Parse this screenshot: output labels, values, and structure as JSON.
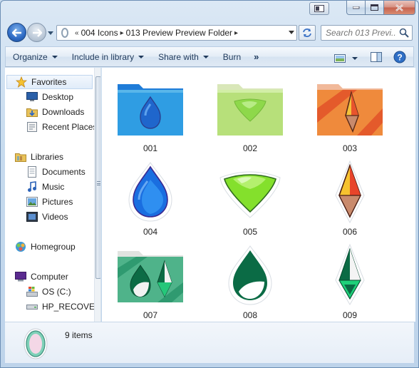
{
  "window": {
    "caption_buttons": [
      "minimize",
      "maximize",
      "close"
    ]
  },
  "nav": {
    "breadcrumbs": [
      "004 Icons",
      "013 Preview Preview Folder"
    ],
    "search_placeholder": "Search 013 Previ..."
  },
  "toolbar": {
    "organize": "Organize",
    "include": "Include in library",
    "share": "Share with",
    "burn": "Burn",
    "more": "»"
  },
  "sidebar": {
    "favorites": {
      "label": "Favorites",
      "items": [
        "Desktop",
        "Downloads",
        "Recent Places"
      ]
    },
    "libraries": {
      "label": "Libraries",
      "items": [
        "Documents",
        "Music",
        "Pictures",
        "Videos"
      ]
    },
    "homegroup": "Homegroup",
    "computer": {
      "label": "Computer",
      "items": [
        "OS (C:)",
        "HP_RECOVERY"
      ]
    }
  },
  "files": [
    {
      "name": "001",
      "icon": "blue-folder-drop-icon"
    },
    {
      "name": "002",
      "icon": "green-folder-gem-icon"
    },
    {
      "name": "003",
      "icon": "orange-folder-crystal-icon"
    },
    {
      "name": "004",
      "icon": "blue-drop-icon"
    },
    {
      "name": "005",
      "icon": "green-gem-icon"
    },
    {
      "name": "006",
      "icon": "orange-crystal-icon"
    },
    {
      "name": "007",
      "icon": "dark-green-folder-icon"
    },
    {
      "name": "008",
      "icon": "dark-green-drop-icon"
    },
    {
      "name": "009",
      "icon": "dark-green-crystal-icon"
    }
  ],
  "details": {
    "count": "9 items",
    "icon": "gem-preview-icon"
  },
  "colors": {
    "accent": "#1e395b",
    "blue": "#1e74e0",
    "green": "#86e02d",
    "dark_green": "#0b6b45",
    "orange": "#e8792b"
  }
}
